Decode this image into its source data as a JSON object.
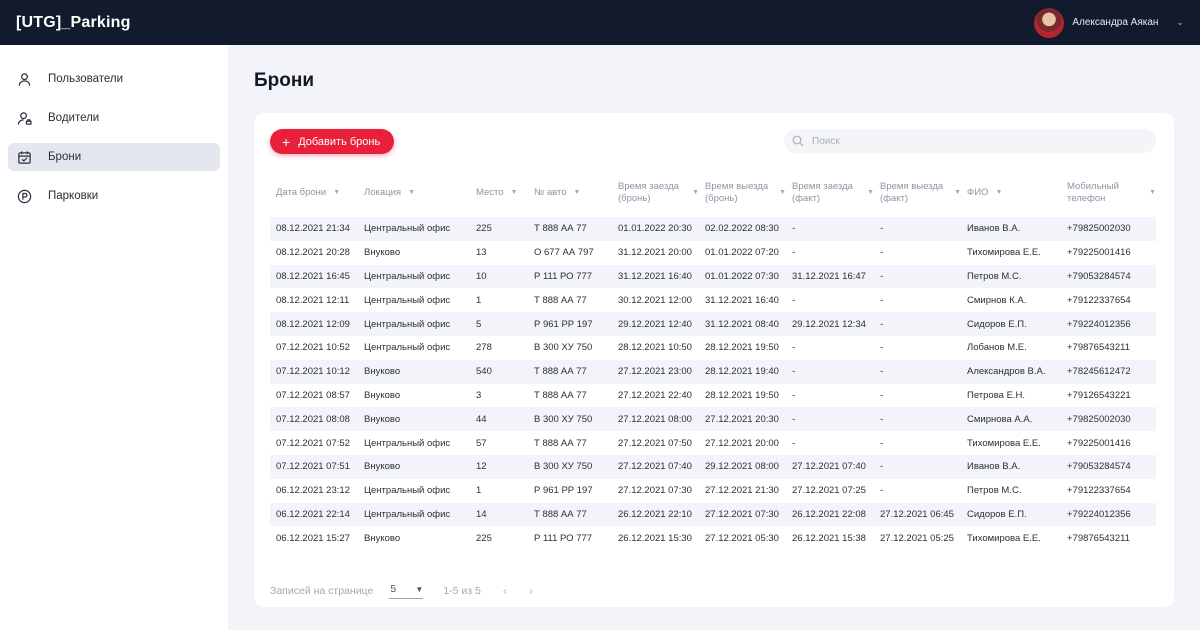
{
  "app": {
    "title": "[UTG]_Parking"
  },
  "user": {
    "name": "Александра Аякан"
  },
  "sidebar": {
    "items": [
      {
        "label": "Пользователи",
        "icon": "user-icon"
      },
      {
        "label": "Водители",
        "icon": "driver-icon"
      },
      {
        "label": "Брони",
        "icon": "calendar-icon",
        "active": true
      },
      {
        "label": "Парковки",
        "icon": "parking-icon"
      }
    ]
  },
  "page": {
    "title": "Брони"
  },
  "toolbar": {
    "add_label": "Добавить бронь",
    "search_placeholder": "Поиск"
  },
  "table": {
    "columns": [
      "Дата брони",
      "Локация",
      "Место",
      "№ авто",
      "Время заезда (бронь)",
      "Время выезда (бронь)",
      "Время заезда (факт)",
      "Время выезда (факт)",
      "ФИО",
      "Мобильный телефон"
    ],
    "rows": [
      [
        "08.12.2021 21:34",
        "Центральный офис",
        "225",
        "Т 888 АА  77",
        "01.01.2022 20:30",
        "02.02.2022 08:30",
        "-",
        "-",
        "Иванов В.А.",
        "+79825002030"
      ],
      [
        "08.12.2021 20:28",
        "Внуково",
        "13",
        "О 677 АА 797",
        "31.12.2021 20:00",
        "01.01.2022 07:20",
        "-",
        "-",
        "Тихомирова Е.Е.",
        "+79225001416"
      ],
      [
        "08.12.2021 16:45",
        "Центральный офис",
        "10",
        "Р 111 РО 777",
        "31.12.2021 16:40",
        "01.01.2022 07:30",
        "31.12.2021 16:47",
        "-",
        "Петров М.С.",
        "+79053284574"
      ],
      [
        "08.12.2021 12:11",
        "Центральный офис",
        "1",
        "Т 888 АА  77",
        "30.12.2021 12:00",
        "31.12.2021 16:40",
        "-",
        "-",
        "Смирнов К.А.",
        "+79122337654"
      ],
      [
        "08.12.2021 12:09",
        "Центральный офис",
        "5",
        "Р 961 РР 197",
        "29.12.2021 12:40",
        "31.12.2021 08:40",
        "29.12.2021 12:34",
        "-",
        "Сидоров Е.П.",
        "+79224012356"
      ],
      [
        "07.12.2021 10:52",
        "Центральный офис",
        "278",
        "В 300 ХУ 750",
        "28.12.2021 10:50",
        "28.12.2021 19:50",
        "-",
        "-",
        "Лобанов М.Е.",
        "+79876543211"
      ],
      [
        "07.12.2021 10:12",
        "Внуково",
        "540",
        "Т 888 АА  77",
        "27.12.2021 23:00",
        "28.12.2021 19:40",
        "-",
        "-",
        "Александров В.А.",
        "+78245612472"
      ],
      [
        "07.12.2021 08:57",
        "Внуково",
        "3",
        "Т 888 АА  77",
        "27.12.2021 22:40",
        "28.12.2021 19:50",
        "-",
        "-",
        "Петрова Е.Н.",
        "+79126543221"
      ],
      [
        "07.12.2021 08:08",
        "Внуково",
        "44",
        "В 300 ХУ 750",
        "27.12.2021 08:00",
        "27.12.2021 20:30",
        "-",
        "-",
        "Смирнова А.А.",
        "+79825002030"
      ],
      [
        "07.12.2021 07:52",
        "Центральный офис",
        "57",
        "Т 888 АА  77",
        "27.12.2021 07:50",
        "27.12.2021 20:00",
        "-",
        "-",
        "Тихомирова Е.Е.",
        "+79225001416"
      ],
      [
        "07.12.2021 07:51",
        "Внуково",
        "12",
        "В 300 ХУ 750",
        "27.12.2021 07:40",
        "29.12.2021 08:00",
        "27.12.2021 07:40",
        "-",
        "Иванов В.А.",
        "+79053284574"
      ],
      [
        "06.12.2021 23:12",
        "Центральный офис",
        "1",
        "Р 961 РР 197",
        "27.12.2021 07:30",
        "27.12.2021 21:30",
        "27.12.2021 07:25",
        "-",
        "Петров М.С.",
        "+79122337654"
      ],
      [
        "06.12.2021 22:14",
        "Центральный офис",
        "14",
        "Т 888 АА  77",
        "26.12.2021 22:10",
        "27.12.2021 07:30",
        "26.12.2021 22:08",
        "27.12.2021 06:45",
        "Сидоров Е.П.",
        "+79224012356"
      ],
      [
        "06.12.2021 15:27",
        "Внуково",
        "225",
        "Р 111 РО 777",
        "26.12.2021 15:30",
        "27.12.2021 05:30",
        "26.12.2021 15:38",
        "27.12.2021 05:25",
        "Тихомирова Е.Е.",
        "+79876543211"
      ]
    ]
  },
  "pagination": {
    "rows_label": "Записей на странице",
    "rows_value": "5",
    "range": "1-5 из 5"
  }
}
